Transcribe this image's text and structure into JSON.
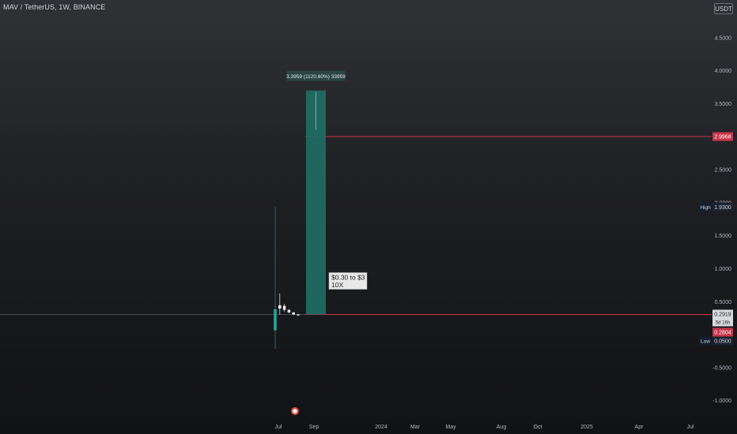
{
  "header": {
    "symbol_title": "MAV / TetherUS, 1W, BINANCE",
    "currency": "USDT"
  },
  "colors": {
    "up": "#26a69a",
    "down": "#ef5350",
    "measure_fill": "#1f6e63",
    "level_line": "#c9344a",
    "price_label_bg": "#c9344a",
    "annotation_bg": "#e8e8e8"
  },
  "chart_data": {
    "type": "candlestick",
    "y_axis": {
      "ticks": [
        "4.5000",
        "4.0000",
        "3.5000",
        "3.0000",
        "2.5000",
        "2.0000",
        "1.5000",
        "1.0000",
        "0.5000",
        "-0.5000",
        "-1.0000"
      ],
      "tick_values": [
        4.5,
        4.0,
        3.5,
        3.0,
        2.5,
        2.0,
        1.5,
        1.0,
        0.5,
        -0.5,
        -1.0
      ],
      "ylim": [
        -1.05,
        4.9
      ]
    },
    "x_axis": {
      "labels": [
        "Jul",
        "Sep",
        "2024",
        "Mar",
        "May",
        "Aug",
        "Oct",
        "2025",
        "Apr",
        "Jul"
      ]
    },
    "candles": [
      {
        "o": 0.38,
        "h": 1.93,
        "l": -0.22,
        "c": 0.06,
        "dir": "down"
      },
      {
        "o": 0.39,
        "h": 0.62,
        "l": 0.3,
        "c": 0.44,
        "dir": "up"
      },
      {
        "o": 0.43,
        "h": 0.46,
        "l": 0.34,
        "c": 0.37,
        "dir": "down"
      },
      {
        "o": 0.37,
        "h": 0.38,
        "l": 0.32,
        "c": 0.33,
        "dir": "down"
      },
      {
        "o": 0.33,
        "h": 0.34,
        "l": 0.29,
        "c": 0.3,
        "dir": "down"
      },
      {
        "o": 0.3,
        "h": 0.31,
        "l": 0.28,
        "c": 0.29,
        "dir": "down"
      }
    ],
    "measure": {
      "from": 0.3,
      "to": 3.6959,
      "label": "3.3959 (1120.60%) 33959",
      "annotation_line1": "$0.30 to $3",
      "annotation_line2": "10X"
    },
    "horizontal_levels": [
      2.9968,
      0.3
    ],
    "price_labels": [
      {
        "text": "2.9968",
        "value": 2.9968,
        "style": "red"
      },
      {
        "text": "High",
        "secondary": "1.9300",
        "value": 1.93,
        "style": "dark"
      },
      {
        "text": "0.2919",
        "value": 0.2919,
        "style": "light"
      },
      {
        "text": "5d 16h",
        "value": 0.21,
        "style": "light-small"
      },
      {
        "text": "0.2804",
        "value": 0.2804,
        "style": "red-below"
      },
      {
        "text": "Low",
        "secondary": "0.0500",
        "value": 0.05,
        "style": "dark-low"
      }
    ]
  }
}
